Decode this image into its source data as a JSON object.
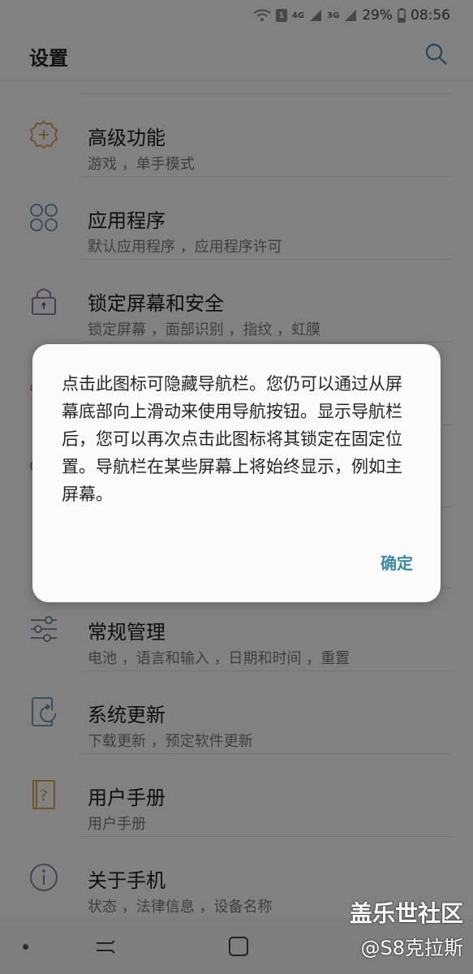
{
  "status_bar": {
    "sim_badge": "1",
    "net1": "4G",
    "net2": "3G",
    "battery": "29%",
    "time": "08:56"
  },
  "app_bar": {
    "title": "设置",
    "search_icon": "search-icon"
  },
  "settings": [
    {
      "title": "高级功能",
      "subtitle": "游戏 ，单手模式",
      "icon": "gear-plus-icon"
    },
    {
      "title": "应用程序",
      "subtitle": "默认应用程序 ，应用程序许可",
      "icon": "apps-grid-icon"
    },
    {
      "title": "锁定屏幕和安全",
      "subtitle": "锁定屏幕 ，面部识别 ，指纹 ，虹膜",
      "icon": "lock-icon"
    },
    {
      "title": "常规管理",
      "subtitle": "电池 ，语言和输入 ，日期和时间 ，重置",
      "icon": "sliders-icon"
    },
    {
      "title": "系统更新",
      "subtitle": "下载更新 ，预定软件更新",
      "icon": "update-icon"
    },
    {
      "title": "用户手册",
      "subtitle": "用户手册",
      "icon": "manual-icon"
    },
    {
      "title": "关于手机",
      "subtitle": "状态 ，法律信息 ，设备名称",
      "icon": "info-icon"
    }
  ],
  "dialog": {
    "message": "点击此图标可隐藏导航栏。您仍可以通过从屏幕底部向上滑动来使用导航按钮。显示导航栏后，您可以再次点击此图标将其锁定在固定位置。导航栏在某些屏幕上将始终显示，例如主屏幕。",
    "ok_label": "确定"
  },
  "watermark": {
    "line1": "盖乐世社区",
    "line2": "@S8克拉斯"
  },
  "colors": {
    "accent": "#3a8aa6",
    "icon_orange": "#d49a3a",
    "icon_blue": "#5b8fb0",
    "icon_purple": "#7a6aa8",
    "icon_gray": "#6f7f8c"
  }
}
